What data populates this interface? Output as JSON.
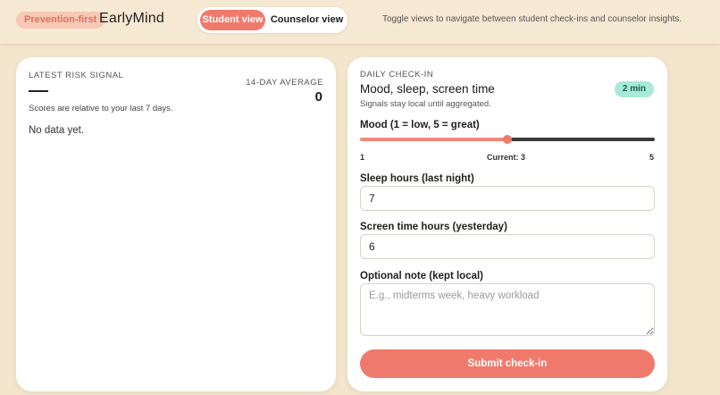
{
  "header": {
    "badge": "Prevention-first",
    "brand": "EarlyMind",
    "toggle": {
      "student_label": "Student view",
      "counselor_label": "Counselor view",
      "active": "student"
    },
    "hint": "Toggle views to navigate between student check-ins and counselor insights."
  },
  "risk_card": {
    "title": "Latest risk signal",
    "avg_label": "14-day average",
    "avg_value": "0",
    "note": "Scores are relative to your last 7 days.",
    "empty": "No data yet."
  },
  "checkin_card": {
    "eyebrow": "Daily check-in",
    "title": "Mood, sleep, screen time",
    "subtitle": "Signals stay local until aggregated.",
    "duration_badge": "2 min",
    "mood": {
      "label": "Mood (1 = low, 5 = great)",
      "min": 1,
      "max": 5,
      "value": 3,
      "min_label": "1",
      "max_label": "5",
      "current_label": "Current: 3"
    },
    "sleep": {
      "label": "Sleep hours (last night)",
      "value": "7"
    },
    "screen": {
      "label": "Screen time hours (yesterday)",
      "value": "6"
    },
    "note": {
      "label": "Optional note (kept local)",
      "placeholder": "E.g., midterms week, heavy workload"
    },
    "submit_label": "Submit check-in"
  },
  "colors": {
    "accent": "#ef7a6c",
    "background": "#f3e6cd",
    "badge_green": "#a7ead7"
  }
}
